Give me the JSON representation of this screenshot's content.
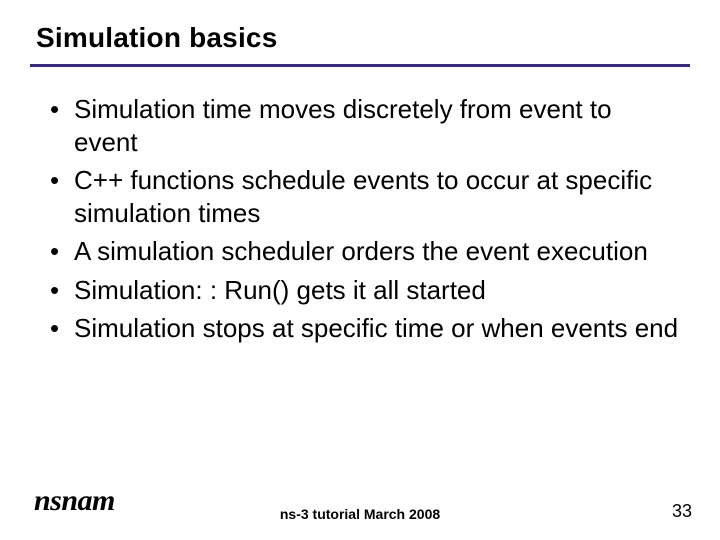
{
  "slide": {
    "title": "Simulation basics",
    "bullets": [
      "Simulation time moves discretely from event to event",
      "C++ functions schedule events to occur at specific simulation times",
      "A simulation scheduler orders the event execution",
      "Simulation: : Run() gets it all started",
      "Simulation stops at specific time or when events end"
    ],
    "footer": "ns-3 tutorial March 2008",
    "page_number": "33",
    "logo_text": "nsnam"
  }
}
